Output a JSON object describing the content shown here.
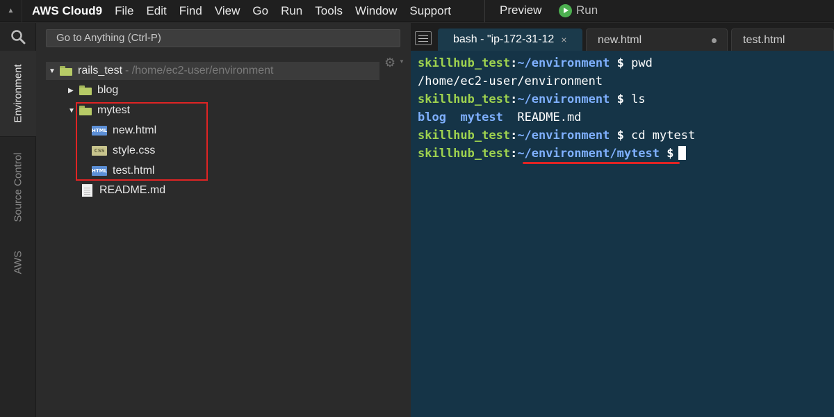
{
  "menubar": {
    "brand": "AWS Cloud9",
    "items": [
      "File",
      "Edit",
      "Find",
      "View",
      "Go",
      "Run",
      "Tools",
      "Window",
      "Support"
    ],
    "preview": "Preview",
    "run": "Run"
  },
  "rail": {
    "tabs": [
      "Environment",
      "Source Control",
      "AWS"
    ]
  },
  "goto": {
    "placeholder": "Go to Anything (Ctrl-P)"
  },
  "tree": {
    "root": {
      "name": "rails_test",
      "path": " - /home/ec2-user/environment"
    },
    "items": [
      {
        "name": "blog"
      },
      {
        "name": "mytest"
      },
      {
        "name": "new.html",
        "icon": "HTML"
      },
      {
        "name": "style.css",
        "icon": "CSS"
      },
      {
        "name": "test.html",
        "icon": "HTML"
      },
      {
        "name": "README.md"
      }
    ]
  },
  "tabs": [
    {
      "label": "bash - \"ip-172-31-12",
      "close": "×"
    },
    {
      "label": "new.html"
    },
    {
      "label": "test.html"
    }
  ],
  "terminal": {
    "user": "skillhub_test",
    "lines": [
      {
        "path": "~/environment",
        "cmd": " pwd"
      },
      {
        "output": "/home/ec2-user/environment"
      },
      {
        "path": "~/environment",
        "cmd": " ls"
      },
      {
        "dirs": [
          "blog",
          "mytest"
        ],
        "files": "README.md"
      },
      {
        "path": "~/environment",
        "cmd": " cd mytest"
      },
      {
        "path": "~/environment/mytest",
        "cmd": ""
      }
    ]
  },
  "colors": {
    "terminal_bg": "#153447",
    "prompt_user": "#9fd34f",
    "prompt_path": "#7fb0ff",
    "annotation_red": "#e02424"
  }
}
